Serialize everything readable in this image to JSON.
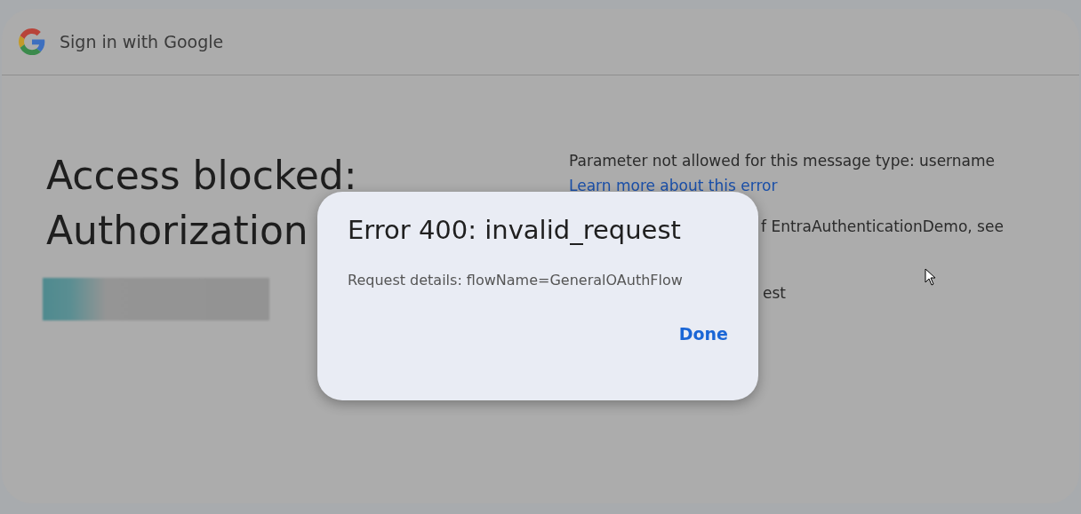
{
  "header": {
    "title": "Sign in with Google"
  },
  "heading": [
    "Access blocked:",
    "Authorization"
  ],
  "details": [
    {
      "kind": "text",
      "text": "Parameter not allowed for this message type: username"
    },
    {
      "kind": "link",
      "text": "Learn more about this error"
    },
    {
      "kind": "partial",
      "text": "f EntraAuthenticationDemo, see"
    },
    {
      "kind": "partial",
      "text": "est"
    }
  ],
  "dialog": {
    "title": "Error 400: invalid_request",
    "body": "Request details: flowName=GeneralOAuthFlow",
    "button": "Done"
  }
}
